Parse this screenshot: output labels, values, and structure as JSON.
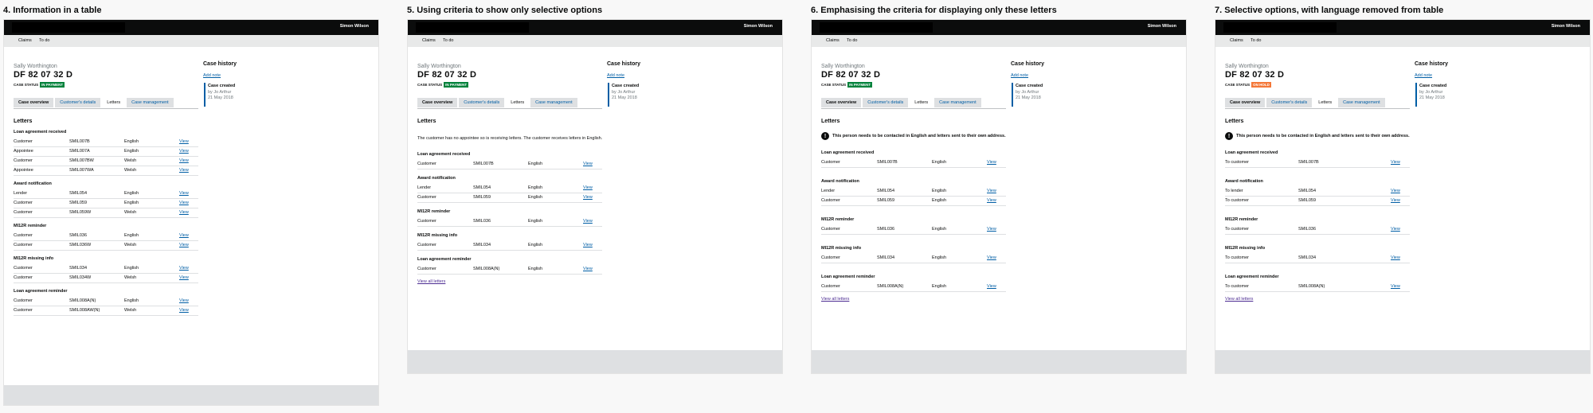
{
  "header": {
    "user_name": "Simon Wilson"
  },
  "subnav": {
    "claims": "Claims",
    "todo": "To do"
  },
  "case": {
    "name": "Sally Worthington",
    "reference": "DF 82 07 32 D",
    "status_label": "CASE STATUS",
    "status_in_payment": "IN PAYMENT",
    "status_on_hold": "ON HOLD"
  },
  "tabs": {
    "overview": "Case overview",
    "customer": "Customer's details",
    "letters": "Letters",
    "management": "Case management"
  },
  "history": {
    "title": "Case history",
    "add_note": "Add note",
    "entry_title": "Case created",
    "entry_by": "by Jo Arthur",
    "entry_date": "21 May 2018"
  },
  "letters_heading": "Letters",
  "view_label": "View",
  "view_all": "View all letters",
  "colors": {
    "in_payment": "#00823b",
    "on_hold": "#f47738",
    "link": "#005ea5"
  },
  "panels": [
    {
      "heading": "4. Information in a table",
      "status": "IN PAYMENT",
      "groups": [
        {
          "title": "Loan agreement received",
          "rows": [
            {
              "recipient": "Customer",
              "code": "SMIL007B",
              "language": "English"
            },
            {
              "recipient": "Appointee",
              "code": "SMIL007A",
              "language": "English"
            },
            {
              "recipient": "Customer",
              "code": "SMIL007BW",
              "language": "Welsh"
            },
            {
              "recipient": "Appointee",
              "code": "SMIL007WA",
              "language": "Welsh"
            }
          ]
        },
        {
          "title": "Award notification",
          "rows": [
            {
              "recipient": "Lender",
              "code": "SMIL054",
              "language": "English"
            },
            {
              "recipient": "Customer",
              "code": "SMIL059",
              "language": "English"
            },
            {
              "recipient": "Customer",
              "code": "SMIL059W",
              "language": "Welsh"
            }
          ]
        },
        {
          "title": "MI12R reminder",
          "rows": [
            {
              "recipient": "Customer",
              "code": "SMIL036",
              "language": "English"
            },
            {
              "recipient": "Customer",
              "code": "SMIL036W",
              "language": "Welsh"
            }
          ]
        },
        {
          "title": "MI12R missing info",
          "rows": [
            {
              "recipient": "Customer",
              "code": "SMIL034",
              "language": "English"
            },
            {
              "recipient": "Customer",
              "code": "SMIL034W",
              "language": "Welsh"
            }
          ]
        },
        {
          "title": "Loan agreement reminder",
          "rows": [
            {
              "recipient": "Customer",
              "code": "SMIL008A(N)",
              "language": "English"
            },
            {
              "recipient": "Customer",
              "code": "SMIL008AW(N)",
              "language": "Welsh"
            }
          ]
        }
      ]
    },
    {
      "heading": "5. Using criteria to show only selective options",
      "status": "IN PAYMENT",
      "intro": "The customer has no appointee so is receiving letters. The customer receives letters in English.",
      "groups": [
        {
          "title": "Loan agreement received",
          "rows": [
            {
              "recipient": "Customer",
              "code": "SMIL007B",
              "language": "English"
            }
          ]
        },
        {
          "title": "Award notification",
          "rows": [
            {
              "recipient": "Lender",
              "code": "SMIL054",
              "language": "English"
            },
            {
              "recipient": "Customer",
              "code": "SMIL059",
              "language": "English"
            }
          ]
        },
        {
          "title": "MI12R reminder",
          "rows": [
            {
              "recipient": "Customer",
              "code": "SMIL036",
              "language": "English"
            }
          ]
        },
        {
          "title": "MI12R missing info",
          "rows": [
            {
              "recipient": "Customer",
              "code": "SMIL034",
              "language": "English"
            }
          ]
        },
        {
          "title": "Loan agreement reminder",
          "rows": [
            {
              "recipient": "Customer",
              "code": "SMIL008A(N)",
              "language": "English"
            }
          ]
        }
      ]
    },
    {
      "heading": "6. Emphasising the criteria for displaying only these letters",
      "status": "IN PAYMENT",
      "callout": "This person needs to be contacted in English and letters sent to their own address.",
      "groups": [
        {
          "title": "Loan agreement received",
          "rows": [
            {
              "recipient": "Customer",
              "code": "SMIL007B",
              "language": "English"
            }
          ]
        },
        {
          "title": "Award notification",
          "rows": [
            {
              "recipient": "Lender",
              "code": "SMIL054",
              "language": "English"
            },
            {
              "recipient": "Customer",
              "code": "SMIL059",
              "language": "English"
            }
          ]
        },
        {
          "title": "MI12R reminder",
          "rows": [
            {
              "recipient": "Customer",
              "code": "SMIL036",
              "language": "English"
            }
          ]
        },
        {
          "title": "MI12R missing info",
          "rows": [
            {
              "recipient": "Customer",
              "code": "SMIL034",
              "language": "English"
            }
          ]
        },
        {
          "title": "Loan agreement reminder",
          "rows": [
            {
              "recipient": "Customer",
              "code": "SMIL008A(N)",
              "language": "English"
            }
          ]
        }
      ]
    },
    {
      "heading": "7. Selective options, with language removed from table",
      "status": "ON HOLD",
      "callout": "This person needs to be contacted in English and letters sent to their own address.",
      "groups": [
        {
          "title": "Loan agreement received",
          "rows": [
            {
              "recipient": "To customer",
              "code": "SMIL007B"
            }
          ]
        },
        {
          "title": "Award notification",
          "rows": [
            {
              "recipient": "To lender",
              "code": "SMIL054"
            },
            {
              "recipient": "To customer",
              "code": "SMIL059"
            }
          ]
        },
        {
          "title": "MI12R reminder",
          "rows": [
            {
              "recipient": "To customer",
              "code": "SMIL036"
            }
          ]
        },
        {
          "title": "MI12R missing info",
          "rows": [
            {
              "recipient": "To customer",
              "code": "SMIL034"
            }
          ]
        },
        {
          "title": "Loan agreement reminder",
          "rows": [
            {
              "recipient": "To customer",
              "code": "SMIL008A(N)"
            }
          ]
        }
      ]
    }
  ]
}
